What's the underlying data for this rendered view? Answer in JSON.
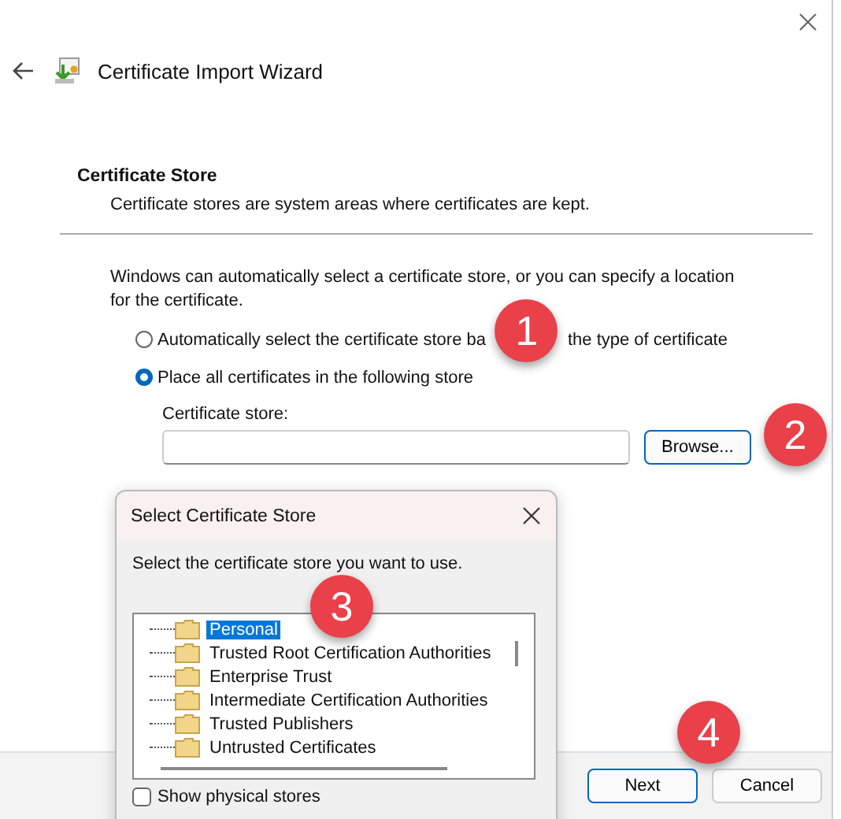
{
  "window": {
    "title": "Certificate Import Wizard"
  },
  "page": {
    "heading": "Certificate Store",
    "description": "Certificate stores are system areas where certificates are kept.",
    "intro": "Windows can automatically select a certificate store, or you can specify a location for the certificate."
  },
  "options": [
    {
      "label": "Automatically select the certificate store ba",
      "label_after": "the type of certificate",
      "selected": false
    },
    {
      "label": "Place all certificates in the following store",
      "selected": true
    }
  ],
  "store_field": {
    "label": "Certificate store:"
  },
  "browse_button": "Browse...",
  "footer_buttons": [
    {
      "label": "Next",
      "default": true
    },
    {
      "label": "Cancel",
      "default": false
    }
  ],
  "dialog": {
    "title": "Select Certificate Store",
    "prompt": "Select the certificate store you want to use.",
    "stores": [
      {
        "label": "Personal",
        "selected": true
      },
      {
        "label": "Trusted Root Certification Authorities",
        "selected": false
      },
      {
        "label": "Enterprise Trust",
        "selected": false
      },
      {
        "label": "Intermediate Certification Authorities",
        "selected": false
      },
      {
        "label": "Trusted Publishers",
        "selected": false
      },
      {
        "label": "Untrusted Certificates",
        "selected": false
      }
    ],
    "show_physical": {
      "label": "Show physical stores",
      "checked": false
    }
  },
  "callouts": [
    "1",
    "2",
    "3",
    "4"
  ]
}
